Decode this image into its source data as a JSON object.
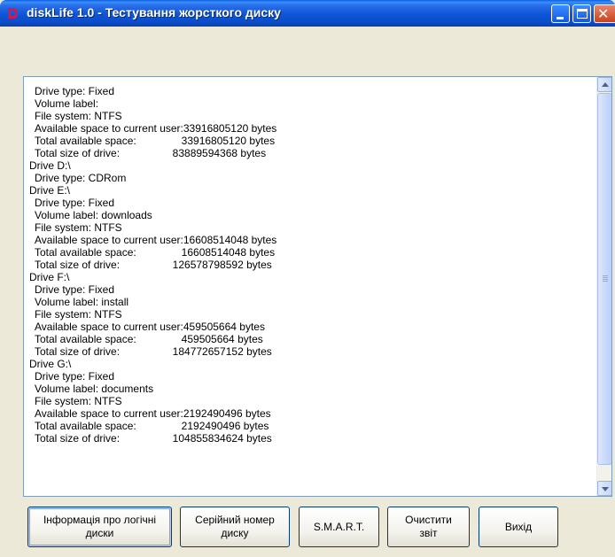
{
  "window": {
    "title": "diskLife 1.0 - Тестування жорсткого диску",
    "icon": "disklife-app-icon",
    "controls": {
      "minimize": "minimize-icon",
      "maximize": "maximize-icon",
      "close": "close-icon"
    }
  },
  "report": {
    "lines": [
      {
        "key": "Drive type: Fixed",
        "value": "",
        "indent": true
      },
      {
        "key": "Volume label:",
        "value": "",
        "indent": true
      },
      {
        "key": "File system: NTFS",
        "value": "",
        "indent": true
      },
      {
        "key": "Available space to current user:",
        "value": "33916805120 bytes",
        "indent": true,
        "tight": true
      },
      {
        "key": "Total available space:",
        "value": "     33916805120 bytes",
        "indent": true
      },
      {
        "key": "Total size of drive:",
        "value": "  83889594368 bytes",
        "indent": true
      },
      {
        "key": "Drive D:\\",
        "value": "",
        "indent": false
      },
      {
        "key": "Drive type: CDRom",
        "value": "",
        "indent": true
      },
      {
        "key": "Drive E:\\",
        "value": "",
        "indent": false
      },
      {
        "key": "Drive type: Fixed",
        "value": "",
        "indent": true
      },
      {
        "key": "Volume label: downloads",
        "value": "",
        "indent": true
      },
      {
        "key": "File system: NTFS",
        "value": "",
        "indent": true
      },
      {
        "key": "Available space to current user:",
        "value": "16608514048 bytes",
        "indent": true,
        "tight": true
      },
      {
        "key": "Total available space:",
        "value": "     16608514048 bytes",
        "indent": true
      },
      {
        "key": "Total size of drive:",
        "value": "  126578798592 bytes",
        "indent": true
      },
      {
        "key": "Drive F:\\",
        "value": "",
        "indent": false
      },
      {
        "key": "Drive type: Fixed",
        "value": "",
        "indent": true
      },
      {
        "key": "Volume label: install",
        "value": "",
        "indent": true
      },
      {
        "key": "File system: NTFS",
        "value": "",
        "indent": true
      },
      {
        "key": "Available space to current user:",
        "value": "459505664 bytes",
        "indent": true,
        "tight": true
      },
      {
        "key": "Total available space:",
        "value": "     459505664 bytes",
        "indent": true
      },
      {
        "key": "Total size of drive:",
        "value": "  184772657152 bytes",
        "indent": true
      },
      {
        "key": "Drive G:\\",
        "value": "",
        "indent": false
      },
      {
        "key": "Drive type: Fixed",
        "value": "",
        "indent": true
      },
      {
        "key": "Volume label: documents",
        "value": "",
        "indent": true
      },
      {
        "key": "File system: NTFS",
        "value": "",
        "indent": true
      },
      {
        "key": "Available space to current user:",
        "value": "2192490496 bytes",
        "indent": true,
        "tight": true
      },
      {
        "key": "Total available space:",
        "value": "     2192490496 bytes",
        "indent": true
      },
      {
        "key": "Total size of drive:",
        "value": "  104855834624 bytes",
        "indent": true
      }
    ]
  },
  "buttons": {
    "logical_disks": "Інформація про логічні\nдиски",
    "serial_number": "Серійний номер\nдиску",
    "smart": "S.M.A.R.T.",
    "clear_report": "Очистити\nзвіт",
    "exit": "Вихід"
  }
}
